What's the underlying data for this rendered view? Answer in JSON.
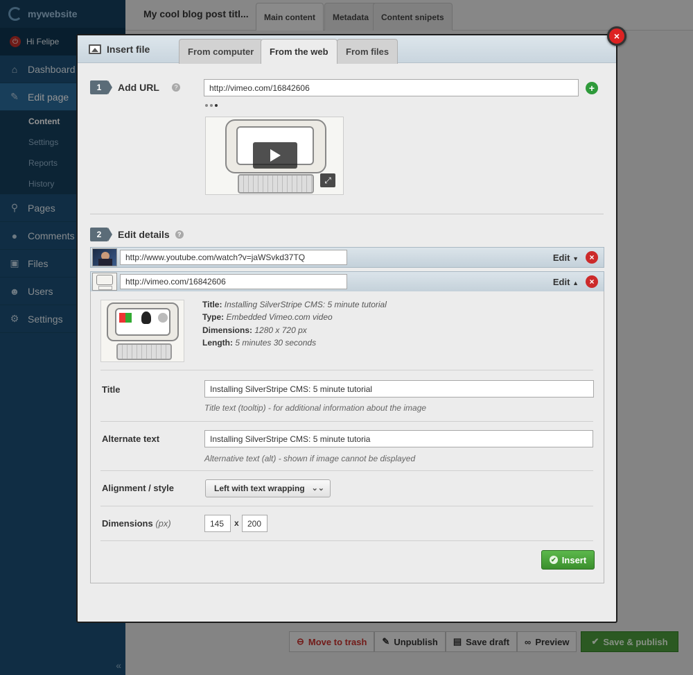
{
  "sidebar": {
    "brand": "mywebsite",
    "user_greeting": "Hi Felipe",
    "nav": [
      {
        "label": "Dashboard",
        "icon": "home-icon"
      },
      {
        "label": "Edit page",
        "icon": "pencil-icon"
      },
      {
        "label": "Pages",
        "icon": "sitemap-icon"
      },
      {
        "label": "Comments",
        "icon": "comment-icon"
      },
      {
        "label": "Files",
        "icon": "image-icon"
      },
      {
        "label": "Users",
        "icon": "users-icon"
      },
      {
        "label": "Settings",
        "icon": "gear-icon"
      }
    ],
    "subnav": [
      "Content",
      "Settings",
      "Reports",
      "History"
    ],
    "collapse": "«"
  },
  "page": {
    "title": "My cool blog post titl...",
    "tabs": [
      "Main content",
      "Metadata",
      "Content snipets"
    ],
    "actions": {
      "trash": "Move to trash",
      "unpublish": "Unpublish",
      "save_draft": "Save draft",
      "preview": "Preview",
      "publish": "Save & publish"
    }
  },
  "dialog": {
    "title": "Insert file",
    "tabs": [
      "From computer",
      "From the web",
      "From files"
    ],
    "active_tab": "From the web",
    "close": "×",
    "step1": {
      "num": "1",
      "label": "Add URL",
      "url_value": "http://vimeo.com/16842606",
      "add": "+"
    },
    "step2": {
      "num": "2",
      "label": "Edit details"
    },
    "files": [
      {
        "url": "http://www.youtube.com/watch?v=jaWSvkd37TQ",
        "edit": "Edit",
        "expanded": false
      },
      {
        "url": "http://vimeo.com/16842606",
        "edit": "Edit",
        "expanded": true
      }
    ],
    "details": {
      "meta": {
        "title_label": "Title:",
        "title_value": "Installing SilverStripe CMS: 5 minute tutorial",
        "type_label": "Type:",
        "type_value": "Embedded Vimeo.com video",
        "dim_label": "Dimensions:",
        "dim_value": "1280 x 720 px",
        "len_label": "Length:",
        "len_value": "5 minutes 30 seconds"
      },
      "title_field": {
        "label": "Title",
        "value": "Installing SilverStripe CMS: 5 minute tutorial",
        "hint": "Title text (tooltip) - for additional information about the image"
      },
      "alt_field": {
        "label": "Alternate text",
        "value": "Installing SilverStripe CMS: 5 minute tutoria",
        "hint": "Alternative text (alt) - shown if image cannot be displayed"
      },
      "alignment": {
        "label": "Alignment / style",
        "value": "Left with text wrapping"
      },
      "dimensions": {
        "label": "Dimensions",
        "unit": "(px)",
        "width": "145",
        "sep": "x",
        "height": "200"
      },
      "insert": "Insert"
    }
  },
  "colors": {
    "sidebar": "#1c4f75",
    "publish": "#4a9a3c",
    "danger": "#cc2a2a",
    "insert": "#3b8f2d"
  }
}
